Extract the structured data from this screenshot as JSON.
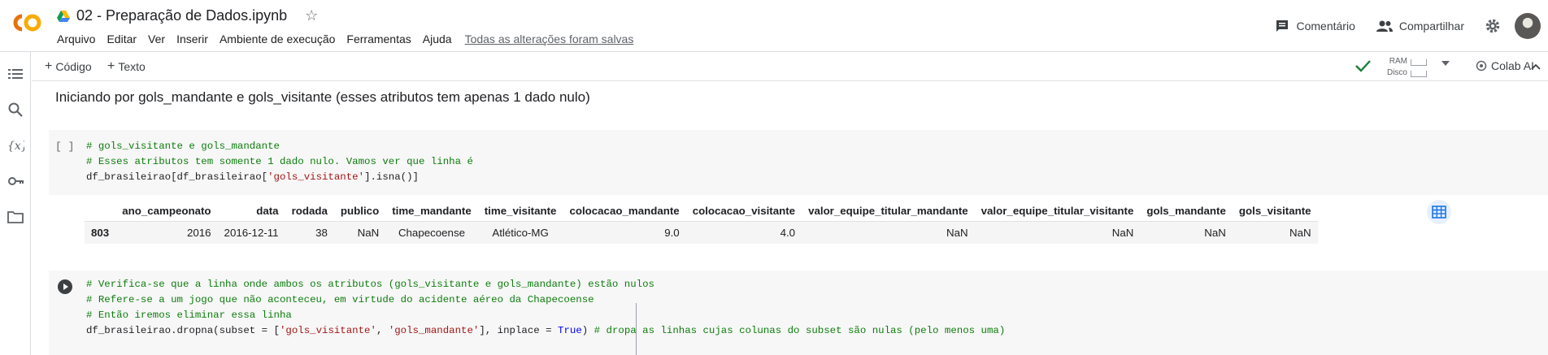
{
  "header": {
    "notebook_title": "02 - Preparação de Dados.ipynb",
    "menu": [
      "Arquivo",
      "Editar",
      "Ver",
      "Inserir",
      "Ambiente de execução",
      "Ferramentas",
      "Ajuda"
    ],
    "save_status": "Todas as alterações foram salvas",
    "comment_label": "Comentário",
    "share_label": "Compartilhar"
  },
  "toolbar": {
    "add_code_label": "Código",
    "add_text_label": "Texto",
    "ram_label": "RAM",
    "disk_label": "Disco",
    "colab_ai_label": "Colab AI"
  },
  "sidebar": {
    "icons": [
      "table-of-contents-icon",
      "search-icon",
      "variables-icon",
      "secrets-key-icon",
      "files-folder-icon"
    ]
  },
  "markdown_text": "Iniciando por gols_mandante e gols_visitante (esses atributos tem apenas 1 dado nulo)",
  "cell1": {
    "exec_indicator": "[ ]",
    "line1": "# gols_visitante e gols_mandante",
    "line2": "# Esses atributos tem somente 1 dado nulo. Vamos ver que linha é",
    "line3_pre": "df_brasileirao[df_brasileirao[",
    "line3_str": "'gols_visitante'",
    "line3_post": "].isna()]"
  },
  "output_table": {
    "columns": [
      "",
      "ano_campeonato",
      "data",
      "rodada",
      "publico",
      "time_mandante",
      "time_visitante",
      "colocacao_mandante",
      "colocacao_visitante",
      "valor_equipe_titular_mandante",
      "valor_equipe_titular_visitante",
      "gols_mandante",
      "gols_visitante"
    ],
    "rows": [
      [
        "803",
        "2016",
        "2016-12-11",
        "38",
        "NaN",
        "Chapecoense",
        "Atlético-MG",
        "9.0",
        "4.0",
        "NaN",
        "NaN",
        "NaN",
        "NaN"
      ]
    ]
  },
  "cell2": {
    "line1": "# Verifica-se que a linha onde ambos os atributos (gols_visitante e gols_mandante) estão nulos",
    "line2": "# Refere-se a um jogo que não aconteceu, em virtude do acidente aéreo da Chapecoense",
    "line3": "# Então iremos eliminar essa linha",
    "line4_a": "df_brasileirao.dropna(subset = [",
    "line4_s1": "'gols_visitante'",
    "line4_b": ", ",
    "line4_s2": "'gols_mandante'",
    "line4_c": "], inplace = ",
    "line4_kw": "True",
    "line4_d": ") ",
    "line4_cm": "# dropa as linhas cujas colunas do subset são nulas (pelo menos uma)"
  },
  "colors": {
    "colab_orange": "#F9AB00",
    "colab_orange_dark": "#E8710A",
    "comment_green": "#0d7d0d",
    "string_red": "#a31515",
    "keyword_blue": "#0000ff",
    "check_green": "#188038"
  }
}
